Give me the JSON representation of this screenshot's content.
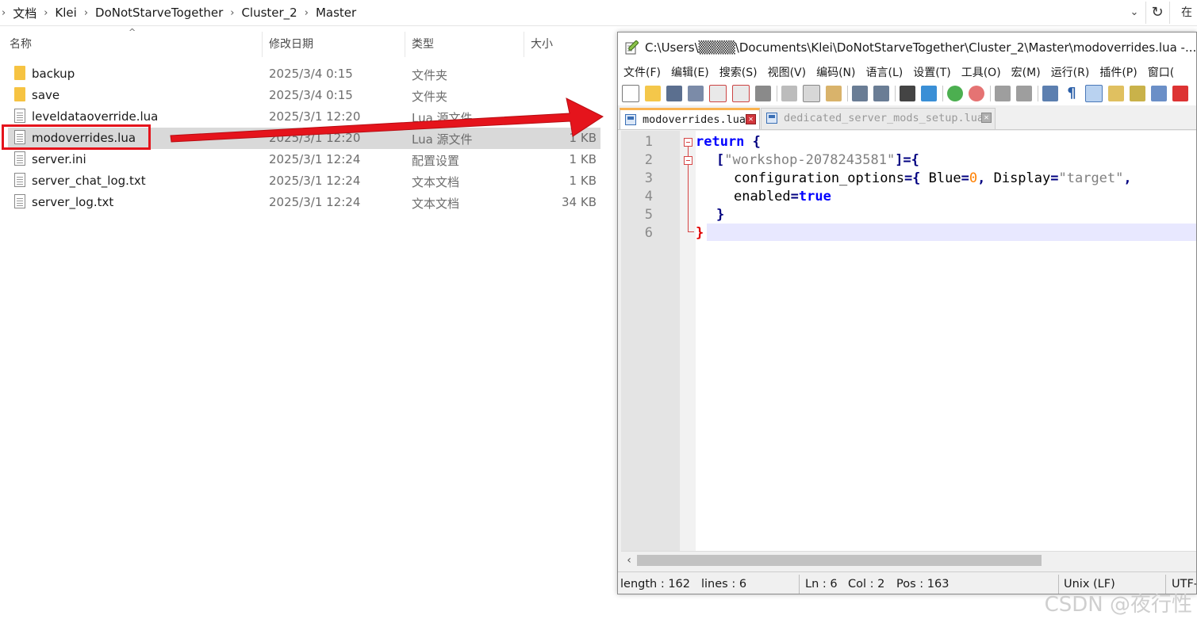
{
  "explorer": {
    "breadcrumb": [
      "文档",
      "Klei",
      "DoNotStarveTogether",
      "Cluster_2",
      "Master"
    ],
    "search_partial": "在",
    "columns": {
      "name": "名称",
      "date": "修改日期",
      "type": "类型",
      "size": "大小"
    },
    "files": [
      {
        "name": "backup",
        "date": "2025/3/4 0:15",
        "type": "文件夹",
        "size": "",
        "icon": "folder-icon"
      },
      {
        "name": "save",
        "date": "2025/3/4 0:15",
        "type": "文件夹",
        "size": "",
        "icon": "folder-icon"
      },
      {
        "name": "leveldataoverride.lua",
        "date": "2025/3/1 12:20",
        "type": "Lua 源文件",
        "size": "",
        "icon": "file-icon"
      },
      {
        "name": "modoverrides.lua",
        "date": "2025/3/1 12:20",
        "type": "Lua 源文件",
        "size": "1 KB",
        "icon": "file-icon"
      },
      {
        "name": "server.ini",
        "date": "2025/3/1 12:24",
        "type": "配置设置",
        "size": "1 KB",
        "icon": "settings-file-icon"
      },
      {
        "name": "server_chat_log.txt",
        "date": "2025/3/1 12:24",
        "type": "文本文档",
        "size": "1 KB",
        "icon": "text-file-icon"
      },
      {
        "name": "server_log.txt",
        "date": "2025/3/1 12:24",
        "type": "文本文档",
        "size": "34 KB",
        "icon": "text-file-icon"
      }
    ],
    "selected_file": "modoverrides.lua"
  },
  "annotation": {
    "highlight_color": "#e5141c"
  },
  "notepad": {
    "title": "C:\\Users\\▒▒▒▒\\Documents\\Klei\\DoNotStarveTogether\\Cluster_2\\Master\\modoverrides.lua -...",
    "menu": [
      "文件(F)",
      "编辑(E)",
      "搜索(S)",
      "视图(V)",
      "编码(N)",
      "语言(L)",
      "设置(T)",
      "工具(O)",
      "宏(M)",
      "运行(R)",
      "插件(P)",
      "窗口("
    ],
    "tabs": [
      {
        "label": "modoverrides.lua",
        "active": true
      },
      {
        "label": "dedicated_server_mods_setup.lua",
        "active": false
      }
    ],
    "line_numbers": [
      "1",
      "2",
      "3",
      "4",
      "5",
      "6"
    ],
    "code": {
      "l1_kw": "return",
      "l1_brace": " {",
      "l2_open": "[",
      "l2_str": "\"workshop-2078243581\"",
      "l2_close": "]={",
      "l3_a": "configuration_options",
      "l3_b": "={ ",
      "l3_c": "Blue",
      "l3_d": "=",
      "l3_e": "0",
      "l3_f": ", ",
      "l3_g": "Display",
      "l3_h": "=",
      "l3_i": "\"target\"",
      "l3_j": ",",
      "l4_a": "enabled",
      "l4_b": "=",
      "l4_c": "true",
      "l5": "}",
      "l6": "}"
    },
    "status": {
      "length": "length : 162",
      "lines": "lines : 6",
      "ln": "Ln : 6",
      "col": "Col : 2",
      "pos": "Pos : 163",
      "eol": "Unix (LF)",
      "encoding": "UTF-"
    }
  },
  "watermark": "CSDN @夜行性"
}
